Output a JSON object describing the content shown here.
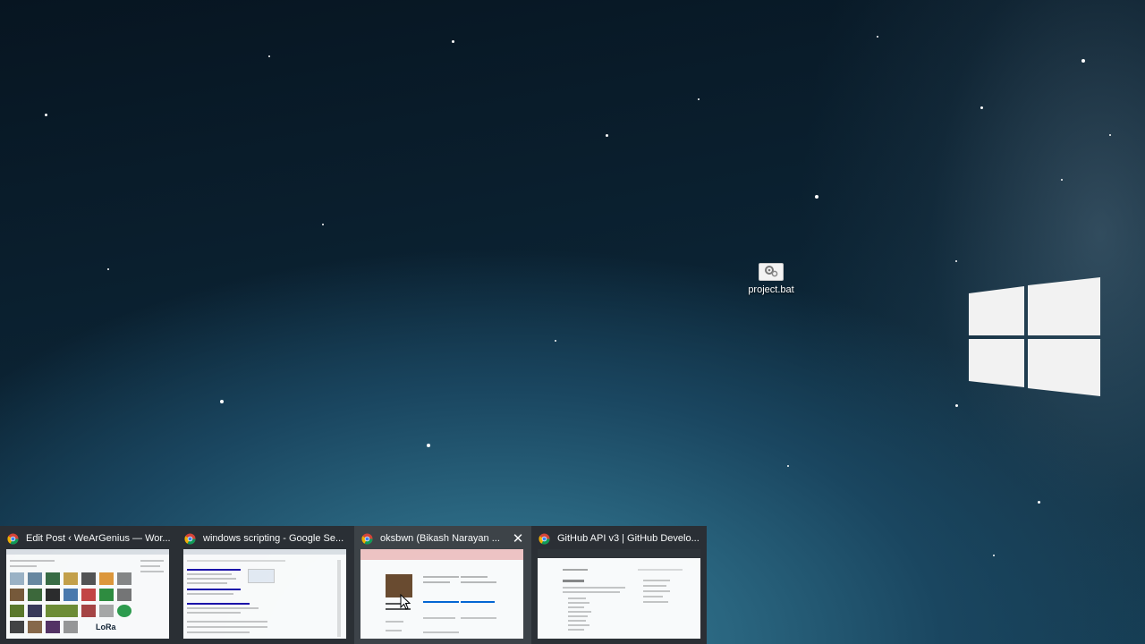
{
  "desktop": {
    "icons": [
      {
        "label": "project.bat",
        "icon": "batch-file-icon"
      }
    ],
    "colors": {
      "wallpaper_dark": "#071521",
      "wallpaper_light": "#3b7f97",
      "logo": "#f2f2f2"
    }
  },
  "taskbar_preview": {
    "background": "#2b2e33",
    "thumbnails": [
      {
        "title": "Edit Post ‹ WeArGenius — Wor...",
        "icon": "chrome-icon",
        "active": false,
        "page_text": "LoRa"
      },
      {
        "title": "windows scripting - Google Se...",
        "icon": "chrome-icon",
        "active": false
      },
      {
        "title": "oksbwn (Bikash Narayan ...",
        "icon": "chrome-icon",
        "active": true,
        "close_icon": "close-icon"
      },
      {
        "title": "GitHub API v3 | GitHub Develo...",
        "icon": "chrome-icon",
        "active": false
      }
    ]
  }
}
